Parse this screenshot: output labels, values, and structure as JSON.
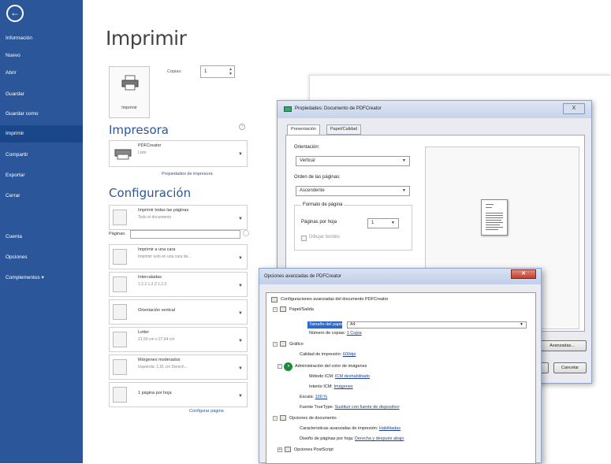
{
  "sidebar": {
    "back_glyph": "←",
    "items": [
      {
        "label": "Información"
      },
      {
        "label": "Nuevo"
      },
      {
        "label": "Abrir"
      },
      {
        "label": "Guardar"
      },
      {
        "label": "Guardar como"
      },
      {
        "label": "Imprimir"
      },
      {
        "label": "Compartir"
      },
      {
        "label": "Exportar"
      },
      {
        "label": "Cerrar"
      },
      {
        "label": "Cuenta"
      },
      {
        "label": "Opciones"
      },
      {
        "label": "Complementos ▾"
      }
    ]
  },
  "print": {
    "title": "Imprimir",
    "button_label": "Imprimir",
    "copies_label": "Copias:",
    "copies_value": "1"
  },
  "printer": {
    "section_title": "Impresora",
    "name": "PDFCreator",
    "status": "Listo",
    "properties_link": "Propiedades de impresora"
  },
  "config": {
    "section_title": "Configuración",
    "pages_label": "Páginas:",
    "settings": [
      {
        "main": "Imprimir todas las páginas",
        "sub": "Todo el documento"
      },
      {
        "main": "Imprimir a una cara",
        "sub": "Imprimir solo en una cara de..."
      },
      {
        "main": "Intercaladas",
        "sub": "1,2,3   1,2,3   1,2,3"
      },
      {
        "main": "Orientación vertical",
        "sub": ""
      },
      {
        "main": "Letter",
        "sub": "21,59 cm x 27,94 cm"
      },
      {
        "main": "Márgenes moderados",
        "sub": "Izquierda: 1,91 cm   Derech..."
      },
      {
        "main": "1 página por hoja",
        "sub": ""
      }
    ],
    "page_setup_link": "Configurar página"
  },
  "properties_dialog": {
    "title": "Propiedades: Documento de PDFCreator",
    "close_glyph": "X",
    "tabs": [
      {
        "label": "Presentación"
      },
      {
        "label": "Papel/Calidad"
      }
    ],
    "orientation_label": "Orientación:",
    "orientation_value": "Vertical",
    "page_order_label": "Orden de las páginas:",
    "page_order_value": "Ascendente",
    "page_format_label": "Formato de página",
    "pages_per_sheet_label": "Páginas por hoja",
    "pages_per_sheet_value": "1",
    "draw_borders_label": "Dibujar bordes",
    "advanced_button": "Avanzadas...",
    "ok_button": "Aceptar",
    "cancel_button": "Cancelar"
  },
  "advanced_dialog": {
    "title": "Opciones avanzadas de PDFCreator",
    "tree": {
      "root": "Configuraciones avanzadas del documento PDFCreator",
      "paper_output": "Papel/Salida",
      "paper_size_label": "Tamaño del papel:",
      "paper_size_value": "A4",
      "copies_label": "Número de copias:",
      "copies_value": "1 Copia",
      "graphic": "Gráfico",
      "print_quality_label": "Calidad de impresión:",
      "print_quality_value": "600dpi",
      "color_mgmt": "Administración del color de imágenes",
      "icm_method_label": "Método ICM:",
      "icm_method_value": "ICM deshabilitado",
      "icm_intent_label": "Intento ICM:",
      "icm_intent_value": "Imágenes",
      "scale_label": "Escala:",
      "scale_value": "100 %",
      "truetype_label": "Fuente TrueType:",
      "truetype_value": "Sustituir con fuente de dispositivo",
      "doc_options": "Opciones de documento",
      "adv_features_label": "Características avanzadas de impresión:",
      "adv_features_value": "Habilitadas",
      "page_design_label": "Diseño de páginas por hoja:",
      "page_design_value": "Derecha y después abajo",
      "postscript": "Opciones PostScript"
    }
  },
  "colors": {
    "sidebar_bg": "#2b579a",
    "accent": "#2b579a",
    "selection": "#3068c6"
  }
}
